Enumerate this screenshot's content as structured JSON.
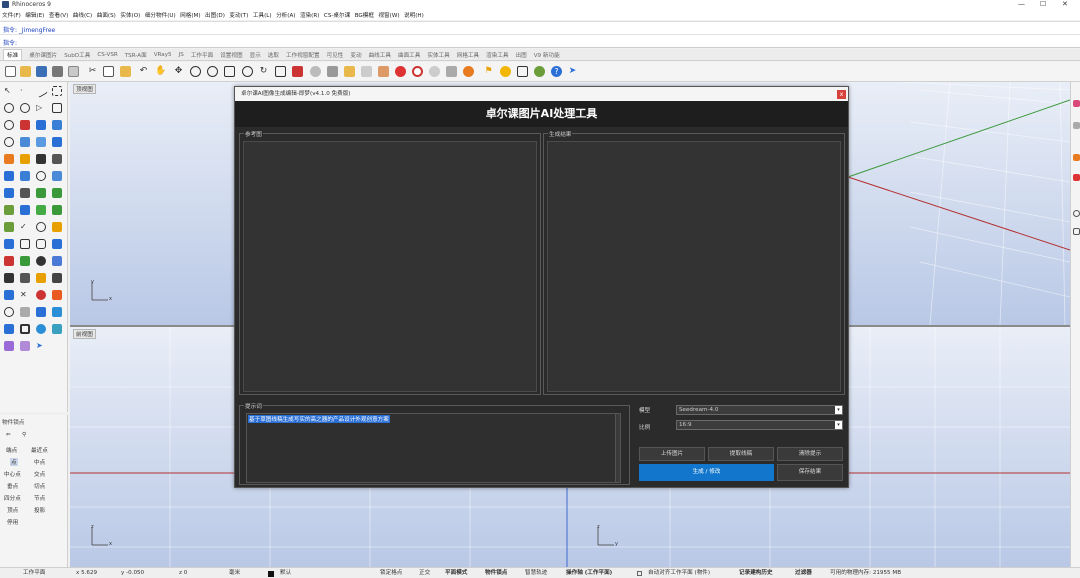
{
  "window": {
    "title": "Rhinoceros 9",
    "controls": [
      "—",
      "☐",
      "✕"
    ]
  },
  "menu": [
    "文件(F)",
    "编辑(E)",
    "查看(V)",
    "曲线(C)",
    "曲面(S)",
    "实体(O)",
    "细分物件(U)",
    "网格(M)",
    "出图(D)",
    "变动(T)",
    "工具(L)",
    "分析(A)",
    "渲染(R)",
    "CS-桌尔课",
    "BG模框",
    "视窗(W)",
    "说明(H)"
  ],
  "command": {
    "history": "指令: _JimengFree",
    "prompt": "指令:"
  },
  "tabs": [
    "标准",
    "桌尔课图片",
    "SubD工具",
    "CS-VSR",
    "TSR-A面",
    "VRay5",
    "JS",
    "工作平面",
    "设置视图",
    "显示",
    "选取",
    "工作视窗配置",
    "可见性",
    "变动",
    "曲线工具",
    "曲面工具",
    "实体工具",
    "网格工具",
    "渲染工具",
    "出图",
    "V9 新功能"
  ],
  "viewports": {
    "top": "顶视图",
    "front": "前视图",
    "axis_x": "x",
    "axis_y": "y",
    "axis_z": "z"
  },
  "osnap": {
    "title": "物件锁点",
    "rows": [
      [
        "端点",
        "最近点"
      ],
      [
        "点",
        "中点"
      ],
      [
        "中心点",
        "交点"
      ],
      [
        "垂点",
        "切点"
      ],
      [
        "四分点",
        "节点"
      ],
      [
        "顶点",
        "投影"
      ],
      [
        "停用",
        ""
      ]
    ]
  },
  "status": {
    "plane": "工作平面",
    "x": "x 5.629",
    "y": "y -0.050",
    "z": "z 0",
    "unit": "毫米",
    "layer": "默认",
    "toggles": [
      "锁定格点",
      "正交",
      "平面模式",
      "物件锁点",
      "智慧轨迹",
      "操作轴 (工作平面)",
      "自动对齐工作平面 (物件)",
      "记录建构历史",
      "过滤器"
    ],
    "memory": "可用的物理内存: 21955 MB"
  },
  "dialog": {
    "title": "卓尔课AI图像生成编辑-即梦(v4.1.0 免费版)",
    "close": "x",
    "header": "卓尔课图片AI处理工具",
    "ref_label": "参考图",
    "result_label": "生成结果",
    "prompt_label": "提示词",
    "prompt_text": "基于草图线稿生成写实的高之器的产品设计外观创意方案",
    "model_label": "模型",
    "model_value": "Seedream-4.0",
    "ratio_label": "比例",
    "ratio_value": "16:9",
    "upload_button": "上传图片",
    "extract_button": "提取线稿",
    "clear_button": "清除提示",
    "generate_button": "生成 / 修改",
    "save_button": "保存结果"
  },
  "colors": {
    "accent": "#1277cc",
    "close": "#d9423a",
    "dialog_bg": "#2b2b2b",
    "viewport_top": "#e9eef7",
    "viewport_bottom": "#b9c8e6"
  }
}
